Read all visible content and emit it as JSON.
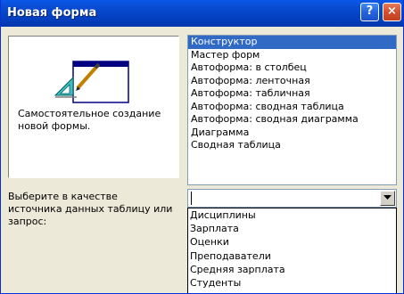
{
  "window": {
    "title": "Новая форма",
    "help_label": "?",
    "close_label": "×"
  },
  "preview": {
    "description": "Самостоятельное создание\nновой формы."
  },
  "form_types": {
    "selected_index": 0,
    "items": [
      "Конструктор",
      "Мастер форм",
      "Автоформа: в столбец",
      "Автоформа: ленточная",
      "Автоформа: табличная",
      "Автоформа:  сводная таблица",
      "Автоформа:  сводная диаграмма",
      "Диаграмма",
      "Сводная таблица"
    ]
  },
  "source": {
    "label": "Выберите в качестве\nисточника данных таблицу или\nзапрос:",
    "value": "",
    "options": [
      "Дисциплины",
      "Зарплата",
      "Оценки",
      "Преподаватели",
      "Средняя зарплата",
      "Студенты"
    ]
  },
  "colors": {
    "titlebar": "#0a4fd6",
    "selection": "#316ac5",
    "window_bg": "#ece9d8"
  },
  "icons": {
    "preview": "form-design-icon",
    "combo_arrow": "chevron-down-icon"
  }
}
